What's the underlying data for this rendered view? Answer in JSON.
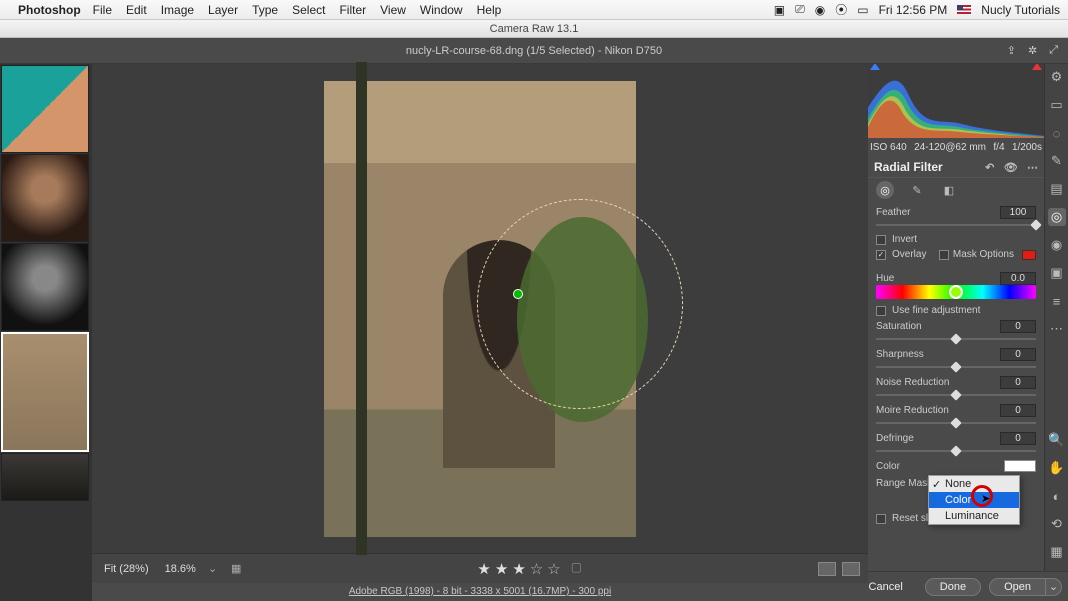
{
  "macos": {
    "app": "Photoshop",
    "menus": [
      "File",
      "Edit",
      "Image",
      "Layer",
      "Type",
      "Select",
      "Filter",
      "View",
      "Window",
      "Help"
    ],
    "clock": "Fri 12:56 PM",
    "user": "Nucly Tutorials"
  },
  "windowTitle": "Camera Raw 13.1",
  "header": {
    "title": "nucly-LR-course-68.dng (1/5 Selected)  -  Nikon D750"
  },
  "exif": {
    "iso": "ISO 640",
    "lens": "24-120@62 mm",
    "aperture": "f/4",
    "shutter": "1/200s"
  },
  "panel": {
    "title": "Radial Filter",
    "feather": {
      "label": "Feather",
      "value": "100"
    },
    "invert": {
      "label": "Invert",
      "checked": false
    },
    "overlay": {
      "label": "Overlay",
      "checked": true
    },
    "maskOptions": {
      "label": "Mask Options",
      "checked": false
    },
    "hue": {
      "label": "Hue",
      "value": "0.0"
    },
    "fineAdj": {
      "label": "Use fine adjustment",
      "checked": false
    },
    "saturation": {
      "label": "Saturation",
      "value": "0"
    },
    "sharpness": {
      "label": "Sharpness",
      "value": "0"
    },
    "noise": {
      "label": "Noise Reduction",
      "value": "0"
    },
    "moire": {
      "label": "Moire Reduction",
      "value": "0"
    },
    "defringe": {
      "label": "Defringe",
      "value": "0"
    },
    "color": {
      "label": "Color"
    },
    "rangeMask": {
      "label": "Range Mask:"
    },
    "dropdown": {
      "items": [
        "None",
        "Color",
        "Luminance"
      ],
      "checkedIndex": 0,
      "hoverIndex": 1
    },
    "reset": {
      "label": "Reset sliders automatically",
      "checked": false
    }
  },
  "zoom": {
    "fit": "Fit (28%)",
    "pct": "18.6%"
  },
  "metadata": "Adobe RGB (1998) - 8 bit - 3338 x 5001 (16.7MP) - 300 ppi",
  "buttons": {
    "cancel": "Cancel",
    "done": "Done",
    "open": "Open"
  }
}
